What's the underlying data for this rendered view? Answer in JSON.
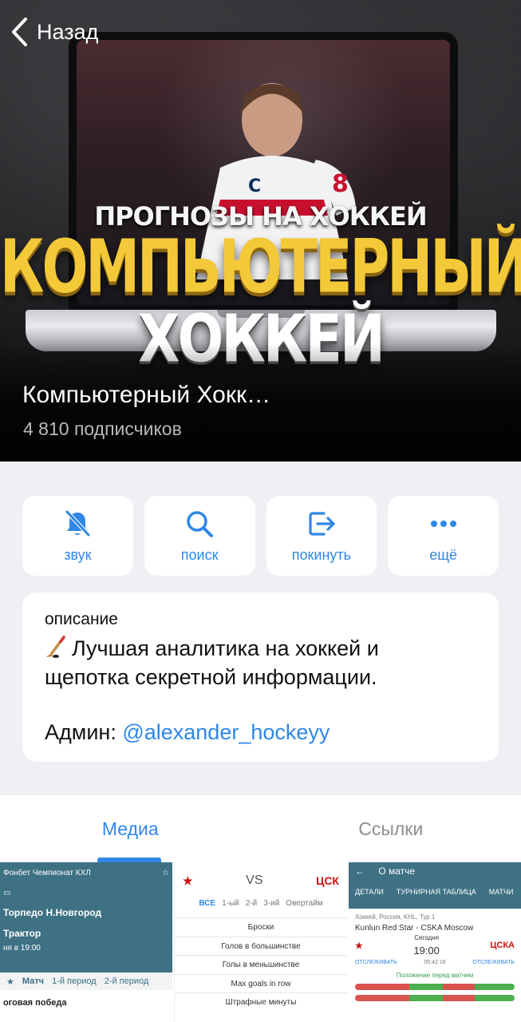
{
  "nav": {
    "back_label": "Назад"
  },
  "channel": {
    "title": "Компьютерный Хокк…",
    "subscribers": "4 810 подписчиков"
  },
  "cover": {
    "line1": "ПРОГНОЗЫ НА ХОККЕЙ",
    "line2": "КОМПЬЮТЕРНЫЙ",
    "line3": "ХОККЕЙ"
  },
  "actions": [
    {
      "label": "звук",
      "icon": "bell-slash-icon"
    },
    {
      "label": "поиск",
      "icon": "search-icon"
    },
    {
      "label": "покинуть",
      "icon": "leave-icon"
    },
    {
      "label": "ещё",
      "icon": "more-icon"
    }
  ],
  "description": {
    "label": "описание",
    "line1": "Лучшая аналитика на хоккей и",
    "line2": "щепотка секретной информации.",
    "admin_prefix": "Админ: ",
    "admin_handle": "@alexander_hockeyy"
  },
  "tabs": [
    {
      "label": "Медиа",
      "active": true
    },
    {
      "label": "Ссылки",
      "active": false
    }
  ],
  "media": {
    "thumb1": {
      "header": "Фонбет Чемпионат КХЛ",
      "team1": "Торпедо Н.Новгород",
      "team2": "Трактор",
      "date": "ня в 19:00",
      "tabs": [
        "Матч",
        "1-й период",
        "2-й период"
      ],
      "bet": "оговая победа"
    },
    "thumb2": {
      "vs": "VS",
      "tabs": [
        "ВСЕ",
        "1-ый",
        "2-й",
        "3-ий",
        "Овертайм"
      ],
      "rows": [
        "Броски",
        "Голов в большинстве",
        "Голы в меньшинстве",
        "Max goals in row",
        "Штрафные минуты"
      ]
    },
    "thumb3": {
      "title": "О матче",
      "tabs": [
        "ДЕТАЛИ",
        "ТУРНИРНАЯ ТАБЛИЦА",
        "МАТЧИ"
      ],
      "league": "Хоккей, Россия, KHL, Тур 1",
      "match": "Kunlun Red Star - CSKA Moscow",
      "day": "Сегодня",
      "time": "19:00",
      "countdown": "05:42:16",
      "follow": "ОТСЛЕЖИВАТЬ",
      "position": "Положение перед матчем"
    }
  },
  "colors": {
    "accent": "#2f87e8",
    "background": "#eff0f4",
    "card": "#ffffff"
  }
}
